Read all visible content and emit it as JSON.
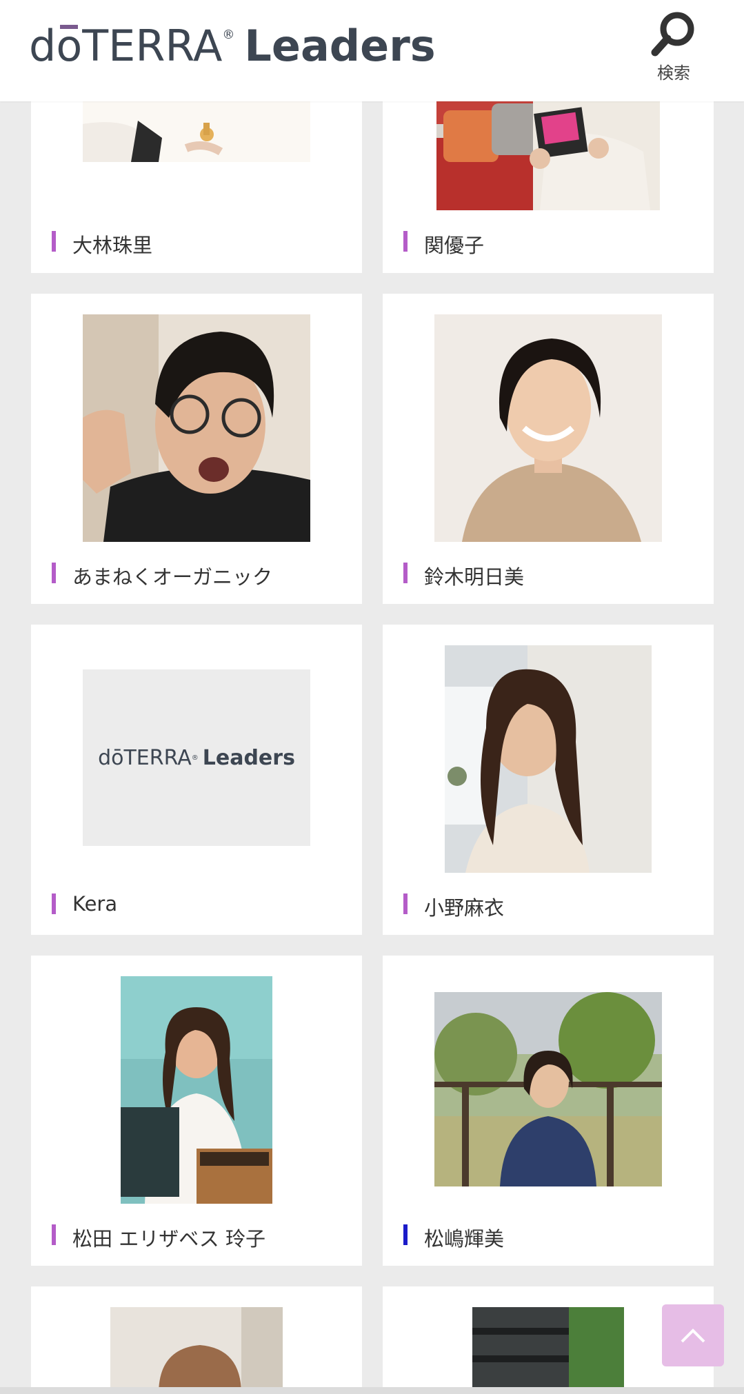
{
  "header": {
    "logo_prefix": "d",
    "logo_o": "o",
    "logo_suffix": "TERRA",
    "logo_reg": "®",
    "logo_leaders": "Leaders",
    "search_label": "検索"
  },
  "leaders": [
    {
      "name": "大林珠里"
    },
    {
      "name": "関優子"
    },
    {
      "name": "あまねくオーガニック"
    },
    {
      "name": "鈴木明日美"
    },
    {
      "name": "Kera",
      "placeholder": "dōTERRA Leaders"
    },
    {
      "name": "小野麻衣"
    },
    {
      "name": "松田 エリザベス 玲子"
    },
    {
      "name": "松嶋輝美"
    }
  ],
  "placeholder_logo": {
    "prefix": "dōTERRA",
    "reg": "®",
    "leaders": "Leaders"
  },
  "colors": {
    "accent": "#b45cc8",
    "accent_alt": "#1b1bc9",
    "to_top_bg": "#e6bde6",
    "page_bg": "#ebebeb"
  },
  "icons": {
    "search": "search-icon",
    "to_top": "chevron-up-icon"
  }
}
